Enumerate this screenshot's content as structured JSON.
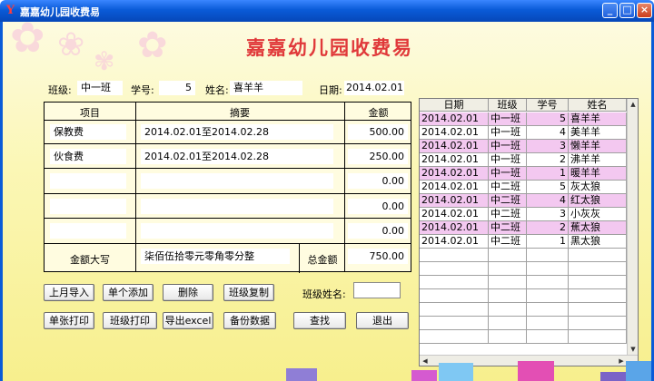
{
  "window": {
    "title": "嘉嘉幼儿园收费易",
    "icon": "app-logo-icon"
  },
  "app_title": "嘉嘉幼儿园收费易",
  "form": {
    "class_label": "班级:",
    "class_value": "中一班",
    "id_label": "学号:",
    "id_value": "5",
    "name_label": "姓名:",
    "name_value": "喜羊羊",
    "date_label": "日期:",
    "date_value": "2014.02.01"
  },
  "grid": {
    "headers": {
      "item": "项目",
      "summary": "摘要",
      "amount": "金额"
    },
    "rows": [
      {
        "item": "保教费",
        "summary": "2014.02.01至2014.02.28",
        "amount": "500.00"
      },
      {
        "item": "伙食费",
        "summary": "2014.02.01至2014.02.28",
        "amount": "250.00"
      },
      {
        "item": "",
        "summary": "",
        "amount": "0.00"
      },
      {
        "item": "",
        "summary": "",
        "amount": "0.00"
      },
      {
        "item": "",
        "summary": "",
        "amount": "0.00"
      }
    ],
    "total_words_label": "金额大写",
    "total_words": "柒佰伍拾零元零角零分整",
    "total_label": "总金额",
    "total_value": "750.00"
  },
  "buttons": {
    "import_last_month": "上月导入",
    "add_single": "单个添加",
    "delete": "删除",
    "copy_class": "班级复制",
    "class_name_label": "班级姓名:",
    "class_name_value": "",
    "print_single": "单张打印",
    "print_class": "班级打印",
    "export_excel": "导出excel",
    "backup": "备份数据",
    "search": "查找",
    "exit": "退出"
  },
  "table": {
    "columns": [
      "日期",
      "班级",
      "学号",
      "姓名"
    ],
    "rows": [
      {
        "date": "2014.02.01",
        "class": "中一班",
        "id": "5",
        "name": "喜羊羊",
        "highlight": true
      },
      {
        "date": "2014.02.01",
        "class": "中一班",
        "id": "4",
        "name": "美羊羊",
        "highlight": false
      },
      {
        "date": "2014.02.01",
        "class": "中一班",
        "id": "3",
        "name": "懒羊羊",
        "highlight": true
      },
      {
        "date": "2014.02.01",
        "class": "中一班",
        "id": "2",
        "name": "沸羊羊",
        "highlight": false
      },
      {
        "date": "2014.02.01",
        "class": "中一班",
        "id": "1",
        "name": "暖羊羊",
        "highlight": true
      },
      {
        "date": "2014.02.01",
        "class": "中二班",
        "id": "5",
        "name": "灰太狼",
        "highlight": false
      },
      {
        "date": "2014.02.01",
        "class": "中二班",
        "id": "4",
        "name": "红太狼",
        "highlight": true
      },
      {
        "date": "2014.02.01",
        "class": "中二班",
        "id": "3",
        "name": "小灰灰",
        "highlight": false
      },
      {
        "date": "2014.02.01",
        "class": "中二班",
        "id": "2",
        "name": "蕉太狼",
        "highlight": true
      },
      {
        "date": "2014.02.01",
        "class": "中二班",
        "id": "1",
        "name": "黑太狼",
        "highlight": false
      }
    ]
  },
  "colors": {
    "titlebar": "#0a5bd8",
    "app_title": "#e0393a",
    "background": "#fbf7b6",
    "row_highlight": "#f3c8f0"
  }
}
